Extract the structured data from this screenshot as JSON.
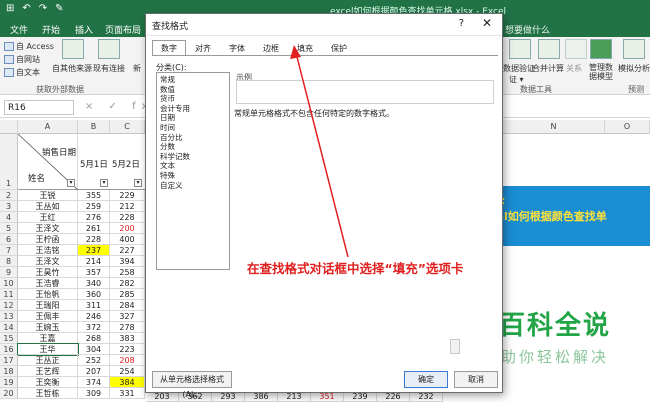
{
  "window": {
    "title": "excel如何根据颜色查找单元格.xlsx - Excel",
    "quick_access": [
      "↶",
      "↷",
      "⊞",
      "✎"
    ]
  },
  "ribbon_tabs": [
    "文件",
    "开始",
    "插入",
    "页面布局"
  ],
  "tell_me": "想要做什么",
  "ribbon": {
    "items": [
      {
        "label": "自 Access"
      },
      {
        "label": "自网站"
      },
      {
        "label": "自文本"
      },
      {
        "label": "自其他来源"
      },
      {
        "label": "现有连接"
      },
      {
        "label": "新"
      }
    ],
    "right_items": [
      {
        "label": "数据验证"
      },
      {
        "label": "合并计算"
      },
      {
        "label": "关系"
      },
      {
        "label": "管理数据模型"
      },
      {
        "label": "模拟分析"
      },
      {
        "label": "预测"
      }
    ],
    "group_labels": [
      "获取外部数据",
      "数据工具",
      "预测"
    ],
    "sub_label": "证 ▾"
  },
  "formula_bar": {
    "name_box": "R16",
    "icons": "× ✓ fx"
  },
  "sheet": {
    "col_headers": [
      "A",
      "B",
      "C"
    ],
    "right_col_headers": [
      "N",
      "O"
    ],
    "header_row": {
      "diag_top": "销售日期",
      "diag_bottom": "姓名",
      "b": "5月1日",
      "c": "5月2日"
    },
    "row_numbers": [
      "1",
      "2",
      "3",
      "4",
      "5",
      "6",
      "7",
      "8",
      "9",
      "10",
      "11",
      "12",
      "13",
      "14",
      "15",
      "16",
      "17",
      "18",
      "19",
      "20"
    ],
    "rows": [
      {
        "name": "王锐",
        "b": "355",
        "c": "229"
      },
      {
        "name": "王丛如",
        "b": "259",
        "c": "212"
      },
      {
        "name": "王红",
        "b": "276",
        "c": "228"
      },
      {
        "name": "王泽文",
        "b": "261",
        "c": "200"
      },
      {
        "name": "王柠函",
        "b": "228",
        "c": "400"
      },
      {
        "name": "王浩铭",
        "b": "237",
        "c": "227"
      },
      {
        "name": "王泽文",
        "b": "214",
        "c": "394"
      },
      {
        "name": "王昊竹",
        "b": "357",
        "c": "258"
      },
      {
        "name": "王浩睿",
        "b": "340",
        "c": "282"
      },
      {
        "name": "王怡帆",
        "b": "360",
        "c": "285"
      },
      {
        "name": "王瑞阳",
        "b": "311",
        "c": "284"
      },
      {
        "name": "王佩丰",
        "b": "246",
        "c": "327"
      },
      {
        "name": "王婉玉",
        "b": "372",
        "c": "278"
      },
      {
        "name": "王嘉",
        "b": "268",
        "c": "383"
      },
      {
        "name": "王华",
        "b": "304",
        "c": "223"
      },
      {
        "name": "王丛正",
        "b": "252",
        "c": "208"
      },
      {
        "name": "王艺辉",
        "b": "207",
        "c": "254"
      },
      {
        "name": "王奕衡",
        "b": "374",
        "c": "384"
      },
      {
        "name": "王哲栋",
        "b": "309",
        "c": "331"
      }
    ],
    "bottom_extra": [
      "203",
      "362",
      "293",
      "386",
      "213",
      "351",
      "239",
      "226",
      "232"
    ],
    "highlight_color": "#ffff00",
    "red_value_color": "#e02020"
  },
  "banner": {
    "line1": "标:",
    "line2": "cel如何根据颜色查找单",
    "line3": "格"
  },
  "watermark": {
    "big": "百科全说",
    "small": "助你轻松解决"
  },
  "dialog": {
    "title": "查找格式",
    "help": "?",
    "close": "✕",
    "tabs": [
      "数字",
      "对齐",
      "字体",
      "边框",
      "填充",
      "保护"
    ],
    "active_tab": "数字",
    "category_label": "分类(C):",
    "categories": [
      "常规",
      "数值",
      "货币",
      "会计专用",
      "日期",
      "时间",
      "百分比",
      "分数",
      "科学记数",
      "文本",
      "特殊",
      "自定义"
    ],
    "sample_label": "示例",
    "description": "常规单元格格式不包含任何特定的数字格式。",
    "from_cell_button": "从单元格选择格式(A)...",
    "ok_button": "确定",
    "cancel_button": "取消"
  },
  "annotation": {
    "text": "在查找格式对话框中选择“填充”选项卡",
    "color": "#e02020"
  }
}
